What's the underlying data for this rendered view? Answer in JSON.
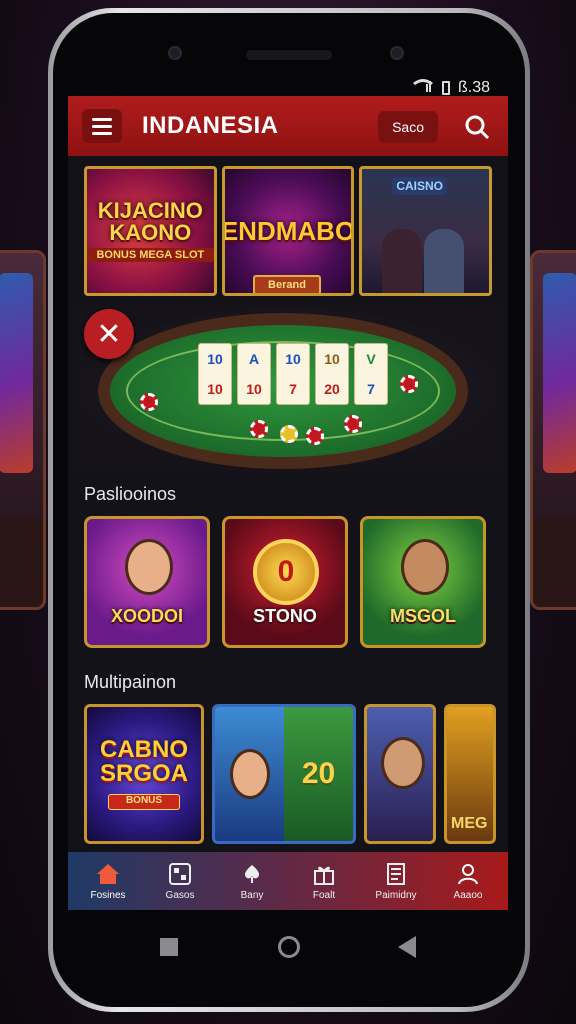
{
  "status_bar": {
    "time": "ß.38"
  },
  "header": {
    "title": "INDANESIA",
    "search_label": "Saco"
  },
  "banners": [
    {
      "title": "KIJACINO KAONO",
      "subtitle": "BONUS MEGA SLOT"
    },
    {
      "title": "ENDMABO",
      "button": "Berand"
    },
    {
      "title": "CAISNO"
    }
  ],
  "table": {
    "cards": [
      [
        "10",
        "10"
      ],
      [
        "A",
        "10"
      ],
      [
        "10",
        "7"
      ],
      [
        "10",
        "20"
      ],
      [
        "V",
        "7"
      ]
    ]
  },
  "section1": {
    "title": "Pasliooinos",
    "tiles": [
      {
        "label": "XOODOI"
      },
      {
        "label": "STONO",
        "medal": "0"
      },
      {
        "label": "MSGOL"
      }
    ]
  },
  "section2": {
    "title": "Multipainon",
    "tiles": [
      {
        "title": "CABNO SRGOA",
        "button": "BONUS"
      },
      {
        "value": "20"
      },
      {
        "label": ""
      },
      {
        "label": "MEG"
      }
    ]
  },
  "nav": {
    "items": [
      {
        "label": "Fosines",
        "icon": "home-icon"
      },
      {
        "label": "Gasos",
        "icon": "games-icon"
      },
      {
        "label": "Bany",
        "icon": "cards-icon"
      },
      {
        "label": "Foalt",
        "icon": "gift-icon"
      },
      {
        "label": "Paimidny",
        "icon": "receipt-icon"
      },
      {
        "label": "Aaaoo",
        "icon": "user-icon"
      }
    ]
  },
  "colors": {
    "accent": "#b01c1c",
    "gold": "#c8952a"
  }
}
